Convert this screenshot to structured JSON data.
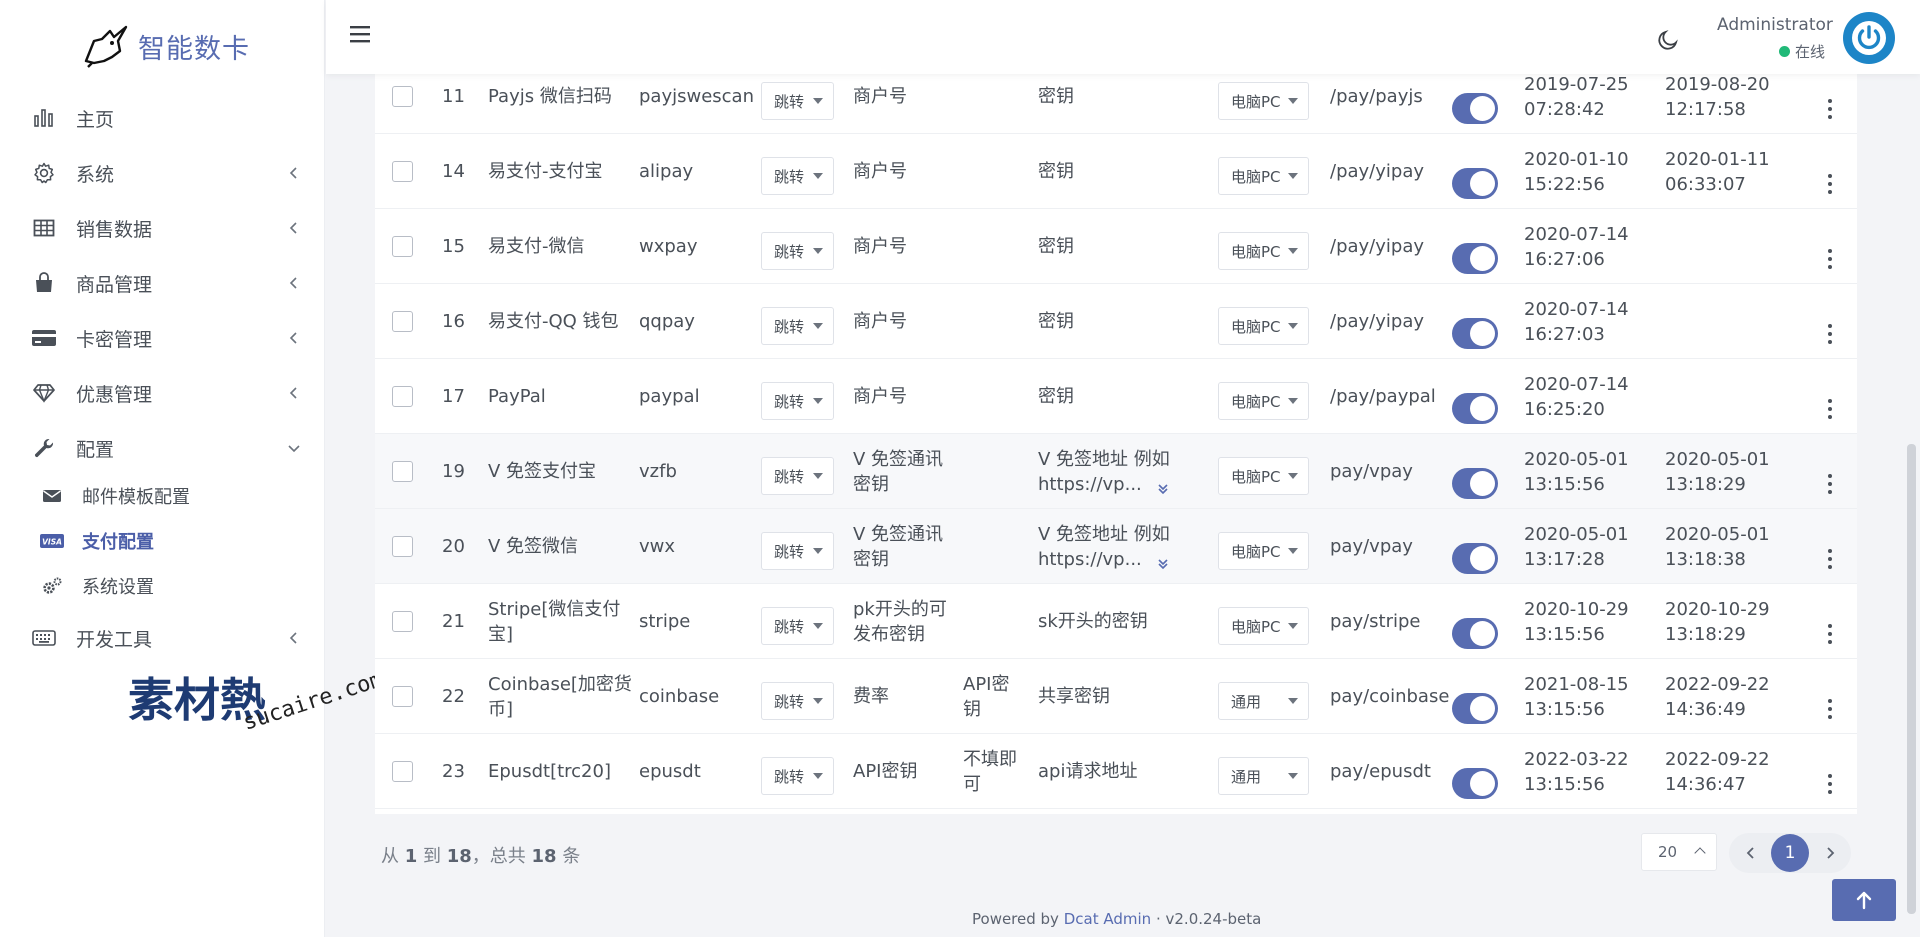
{
  "brand": {
    "name": "智能数卡"
  },
  "sidebar": {
    "items": [
      {
        "label": "主页",
        "icon": "bar-chart-icon"
      },
      {
        "label": "系统",
        "icon": "gear-icon"
      },
      {
        "label": "销售数据",
        "icon": "table-icon"
      },
      {
        "label": "商品管理",
        "icon": "shopping-bag-icon"
      },
      {
        "label": "卡密管理",
        "icon": "credit-card-icon"
      },
      {
        "label": "优惠管理",
        "icon": "diamond-icon"
      },
      {
        "label": "配置",
        "icon": "wrench-icon",
        "expanded": true
      },
      {
        "label": "开发工具",
        "icon": "keyboard-icon"
      }
    ],
    "sub_items": [
      {
        "label": "邮件模板配置",
        "icon": "envelope-icon"
      },
      {
        "label": "支付配置",
        "icon": "visa-card-icon",
        "active": true
      },
      {
        "label": "系统设置",
        "icon": "cogs-icon"
      }
    ],
    "watermark": {
      "text_cn": "素材熱",
      "text_en": "sucaire.com"
    }
  },
  "navbar": {
    "user_name": "Administrator",
    "status": "在线",
    "status_color": "#21b978",
    "accent": "#586cb1"
  },
  "table": {
    "rows": [
      {
        "id": "11",
        "name": "Payjs 微信扫码",
        "code": "payjswescan",
        "method": "跳转",
        "merchant": "商户号",
        "key2": "",
        "secret": "密钥",
        "secret_expand": false,
        "client": "电脑PC",
        "route": "/pay/payjs",
        "enabled": true,
        "created_date": "2019-07-25",
        "created_time": "07:28:42",
        "updated_date": "2019-08-20",
        "updated_time": "12:17:58"
      },
      {
        "id": "14",
        "name": "易支付-支付宝",
        "code": "alipay",
        "method": "跳转",
        "merchant": "商户号",
        "key2": "",
        "secret": "密钥",
        "secret_expand": false,
        "client": "电脑PC",
        "route": "/pay/yipay",
        "enabled": true,
        "created_date": "2020-01-10",
        "created_time": "15:22:56",
        "updated_date": "2020-01-11",
        "updated_time": "06:33:07"
      },
      {
        "id": "15",
        "name": "易支付-微信",
        "code": "wxpay",
        "method": "跳转",
        "merchant": "商户号",
        "key2": "",
        "secret": "密钥",
        "secret_expand": false,
        "client": "电脑PC",
        "route": "/pay/yipay",
        "enabled": true,
        "created_date": "2020-07-14",
        "created_time": "16:27:06",
        "updated_date": "",
        "updated_time": ""
      },
      {
        "id": "16",
        "name": "易支付-QQ 钱包",
        "code": "qqpay",
        "method": "跳转",
        "merchant": "商户号",
        "key2": "",
        "secret": "密钥",
        "secret_expand": false,
        "client": "电脑PC",
        "route": "/pay/yipay",
        "enabled": true,
        "created_date": "2020-07-14",
        "created_time": "16:27:03",
        "updated_date": "",
        "updated_time": ""
      },
      {
        "id": "17",
        "name": "PayPal",
        "code": "paypal",
        "method": "跳转",
        "merchant": "商户号",
        "key2": "",
        "secret": "密钥",
        "secret_expand": false,
        "client": "电脑PC",
        "route": "/pay/paypal",
        "enabled": true,
        "created_date": "2020-07-14",
        "created_time": "16:25:20",
        "updated_date": "",
        "updated_time": ""
      },
      {
        "id": "19",
        "name": "V 免签支付宝",
        "code": "vzfb",
        "method": "跳转",
        "merchant": "V 免签通讯密钥",
        "key2": "",
        "secret": "V 免签地址 例如 https://vp...",
        "secret_expand": true,
        "client": "电脑PC",
        "route": "pay/vpay",
        "enabled": true,
        "created_date": "2020-05-01",
        "created_time": "13:15:56",
        "updated_date": "2020-05-01",
        "updated_time": "13:18:29"
      },
      {
        "id": "20",
        "name": "V 免签微信",
        "code": "vwx",
        "method": "跳转",
        "merchant": "V 免签通讯密钥",
        "key2": "",
        "secret": "V 免签地址 例如 https://vp...",
        "secret_expand": true,
        "client": "电脑PC",
        "route": "pay/vpay",
        "enabled": true,
        "created_date": "2020-05-01",
        "created_time": "13:17:28",
        "updated_date": "2020-05-01",
        "updated_time": "13:18:38"
      },
      {
        "id": "21",
        "name": "Stripe[微信支付宝]",
        "code": "stripe",
        "method": "跳转",
        "merchant": "pk开头的可发布密钥",
        "key2": "",
        "secret": "sk开头的密钥",
        "secret_expand": false,
        "client": "电脑PC",
        "route": "pay/stripe",
        "enabled": true,
        "created_date": "2020-10-29",
        "created_time": "13:15:56",
        "updated_date": "2020-10-29",
        "updated_time": "13:18:29"
      },
      {
        "id": "22",
        "name": "Coinbase[加密货币]",
        "code": "coinbase",
        "method": "跳转",
        "merchant": "费率",
        "key2": "API密钥",
        "secret": "共享密钥",
        "secret_expand": false,
        "client": "通用",
        "route": "pay/coinbase",
        "enabled": true,
        "created_date": "2021-08-15",
        "created_time": "13:15:56",
        "updated_date": "2022-09-22",
        "updated_time": "14:36:49"
      },
      {
        "id": "23",
        "name": "Epusdt[trc20]",
        "code": "epusdt",
        "method": "跳转",
        "merchant": "API密钥",
        "key2": "不填即可",
        "secret": "api请求地址",
        "secret_expand": false,
        "client": "通用",
        "route": "pay/epusdt",
        "enabled": true,
        "created_date": "2022-03-22",
        "created_time": "13:15:56",
        "updated_date": "2022-09-22",
        "updated_time": "14:36:47"
      }
    ]
  },
  "pagination": {
    "summary_prefix": "从",
    "summary_from": "1",
    "summary_to_word": "到",
    "summary_to": "18",
    "summary_total_word": "，总共",
    "summary_total": "18",
    "summary_suffix": "条",
    "per_page": "20",
    "current_page": "1"
  },
  "footer": {
    "powered_prefix": "Powered by",
    "powered_link": "Dcat Admin",
    "version": "· v2.0.24-beta"
  }
}
